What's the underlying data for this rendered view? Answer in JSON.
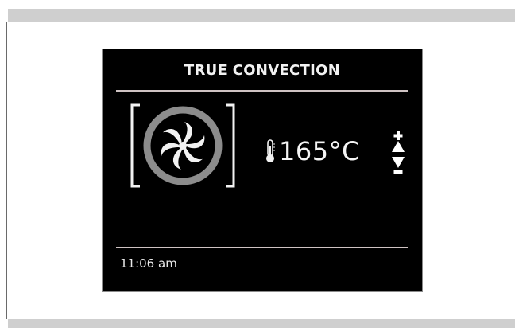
{
  "display": {
    "mode_title": "TRUE CONVECTION",
    "temperature": "165°C",
    "clock": "11:06 am"
  },
  "icons": {
    "fan": "convection-fan-icon",
    "thermometer": "thermometer-icon",
    "increase": "temperature-increase-icon",
    "decrease": "temperature-decrease-icon"
  },
  "colors": {
    "screen_background": "#000000",
    "text": "#ffffff",
    "fan_ring": "#8c8c8c",
    "divider": "#cfc3c3",
    "page_band": "#cfcfcf"
  }
}
